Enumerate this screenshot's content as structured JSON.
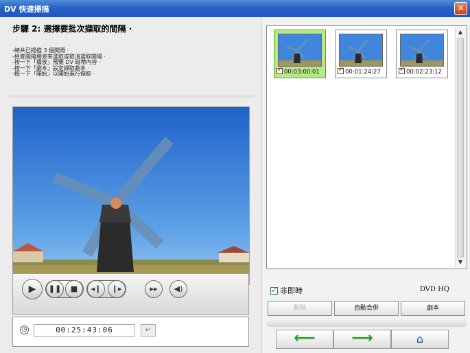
{
  "window": {
    "title": "DV 快速掃描",
    "close_glyph": "✕"
  },
  "step": {
    "heading": "步驟 2: 選擇要批次擷取的間隔 ·"
  },
  "instructions": [
    "-總共已掃描 3 個間隔 ·",
    "-檢查間隔場景來選取或取消選取間隔 ·",
    "-按一下「播放」預覽 DV 磁帶內容 ·",
    "-按一下「劇本」設定擷取劇本 ·",
    "-按一下「開始」以開始進行擷取 ·"
  ],
  "player": {
    "play_icon": "▶",
    "pause_icon": "❚❚",
    "stop_icon": "■",
    "prev_frame_icon": "◂❙",
    "next_frame_icon": "❙▸",
    "fast_forward_icon": "▸▸",
    "volume_icon": "◀)"
  },
  "timecode": {
    "value": "00:25:43:06",
    "clock_icon": "◷",
    "enter_icon": "↵"
  },
  "thumbnails": [
    {
      "timecode": "00:03:00:01",
      "selected": true
    },
    {
      "timecode": "00:01:24:27",
      "selected": false
    },
    {
      "timecode": "00:02:23:12",
      "selected": false
    }
  ],
  "options": {
    "non_realtime_label": "非即時",
    "non_realtime_checked": true,
    "profile": "DVD HQ"
  },
  "actions": {
    "delete_label": "刪除",
    "auto_merge_label": "自動合併",
    "script_label": "劇本"
  },
  "nav": {
    "back_icon": "⟵",
    "next_icon": "⟶",
    "home_icon": "⌂"
  },
  "colors": {
    "title_bar": "#2a62c6",
    "selected_thumb": "#b7e889",
    "nav_arrow": "#27a020",
    "home": "#1a4fb5"
  }
}
